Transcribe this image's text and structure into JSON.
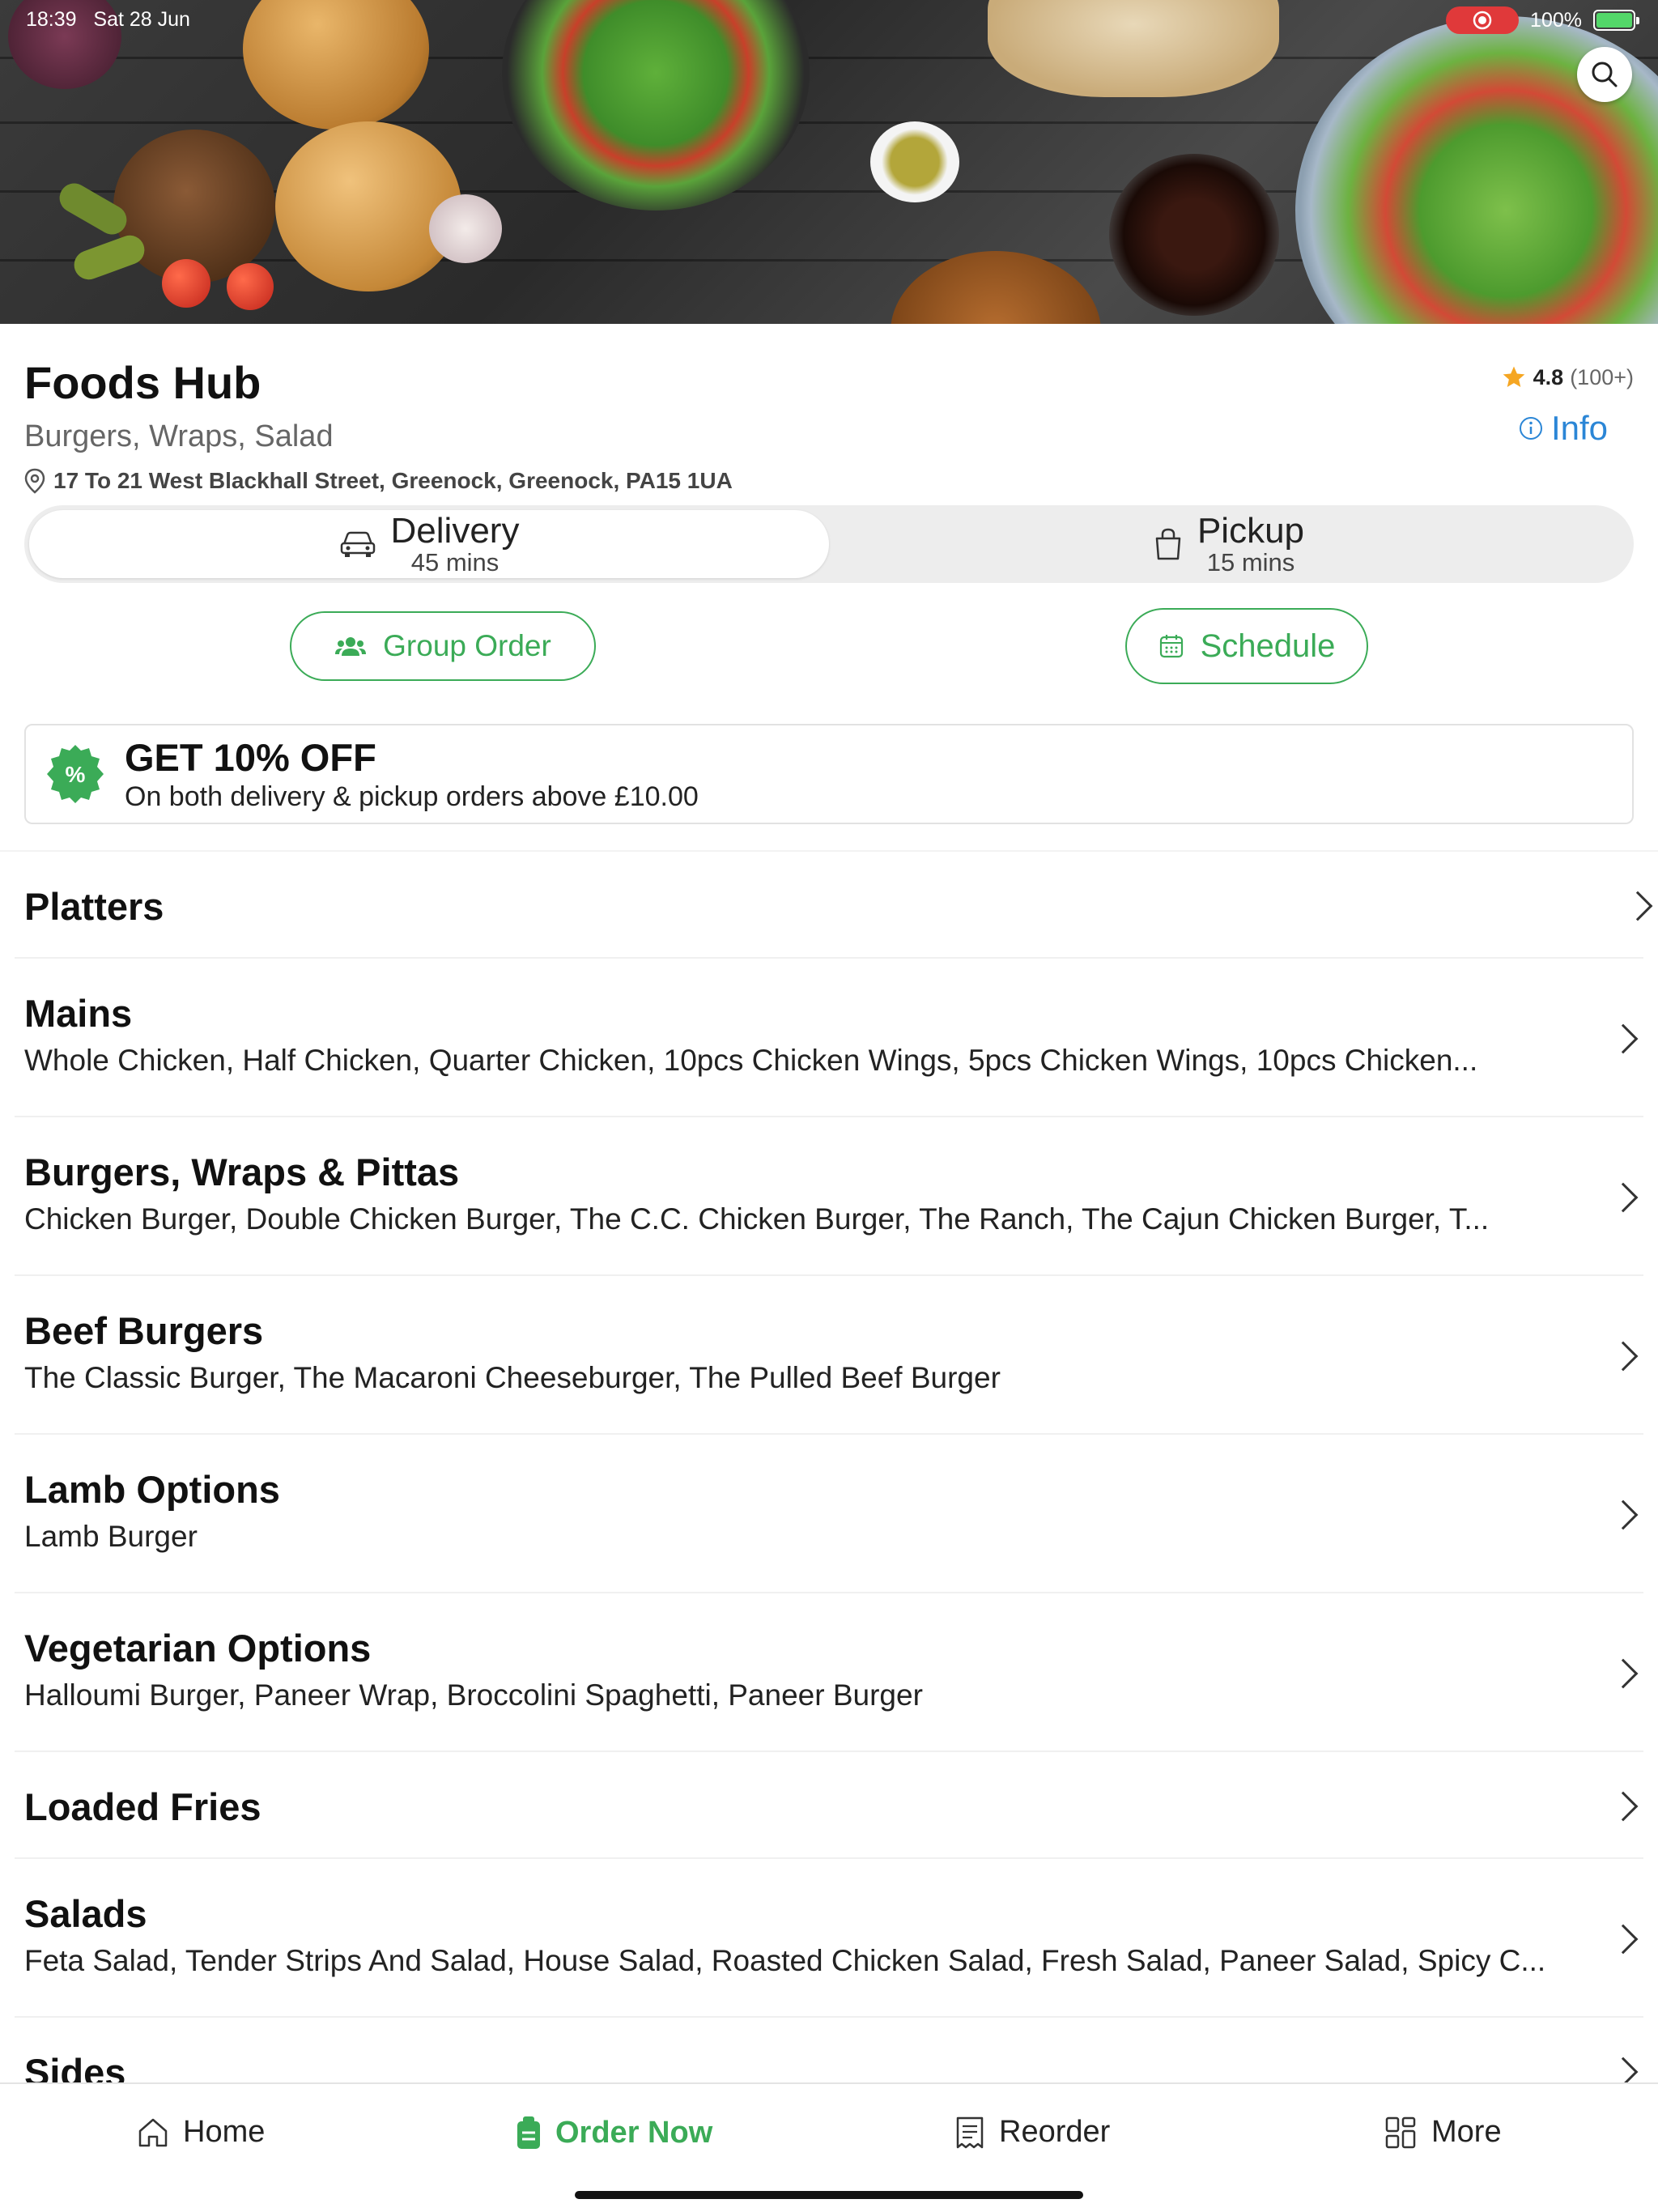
{
  "status_bar": {
    "time": "18:39",
    "date": "Sat 28 Jun",
    "battery": "100%"
  },
  "restaurant": {
    "name": "Foods Hub",
    "cuisine": "Burgers, Wraps, Salad",
    "address": "17 To 21 West Blackhall Street, Greenock, Greenock, PA15 1UA",
    "rating": "4.8",
    "rating_count": "(100+)",
    "info_label": "Info"
  },
  "order_mode": {
    "delivery": {
      "label": "Delivery",
      "time": "45 mins",
      "selected": true
    },
    "pickup": {
      "label": "Pickup",
      "time": "15 mins",
      "selected": false
    }
  },
  "actions": {
    "group_order": "Group Order",
    "schedule": "Schedule"
  },
  "promo": {
    "title": "GET 10% OFF",
    "subtitle": "On both delivery & pickup orders above £10.00",
    "badge_symbol": "%"
  },
  "categories": [
    {
      "title": "Platters",
      "items": ""
    },
    {
      "title": "Mains",
      "items": "Whole Chicken, Half Chicken, Quarter Chicken, 10pcs Chicken Wings, 5pcs Chicken Wings, 10pcs Chicken..."
    },
    {
      "title": "Burgers, Wraps & Pittas",
      "items": "Chicken Burger, Double Chicken Burger, The C.C. Chicken Burger, The Ranch, The Cajun Chicken Burger, T..."
    },
    {
      "title": "Beef Burgers",
      "items": "The Classic Burger, The Macaroni Cheeseburger, The Pulled Beef Burger"
    },
    {
      "title": "Lamb Options",
      "items": "Lamb Burger"
    },
    {
      "title": "Vegetarian Options",
      "items": "Halloumi Burger, Paneer Wrap, Broccolini Spaghetti, Paneer Burger"
    },
    {
      "title": "Loaded Fries",
      "items": ""
    },
    {
      "title": "Salads",
      "items": "Feta Salad, Tender Strips And Salad, House Salad, Roasted Chicken Salad, Fresh Salad, Paneer Salad, Spicy C..."
    },
    {
      "title": "Sides",
      "items": ""
    }
  ],
  "tabs": {
    "home": "Home",
    "order_now": "Order Now",
    "reorder": "Reorder",
    "more": "More"
  },
  "colors": {
    "accent_green": "#3bab57",
    "info_blue": "#2b86d6",
    "star": "#f5a623",
    "record_red": "#e0393a"
  },
  "icons": [
    "search-icon",
    "star-icon",
    "info-icon",
    "location-pin-icon",
    "car-icon",
    "shopping-bag-icon",
    "group-icon",
    "calendar-icon",
    "discount-badge-icon",
    "chevron-right-icon",
    "home-icon",
    "order-bag-icon",
    "receipt-icon",
    "grid-icon"
  ]
}
